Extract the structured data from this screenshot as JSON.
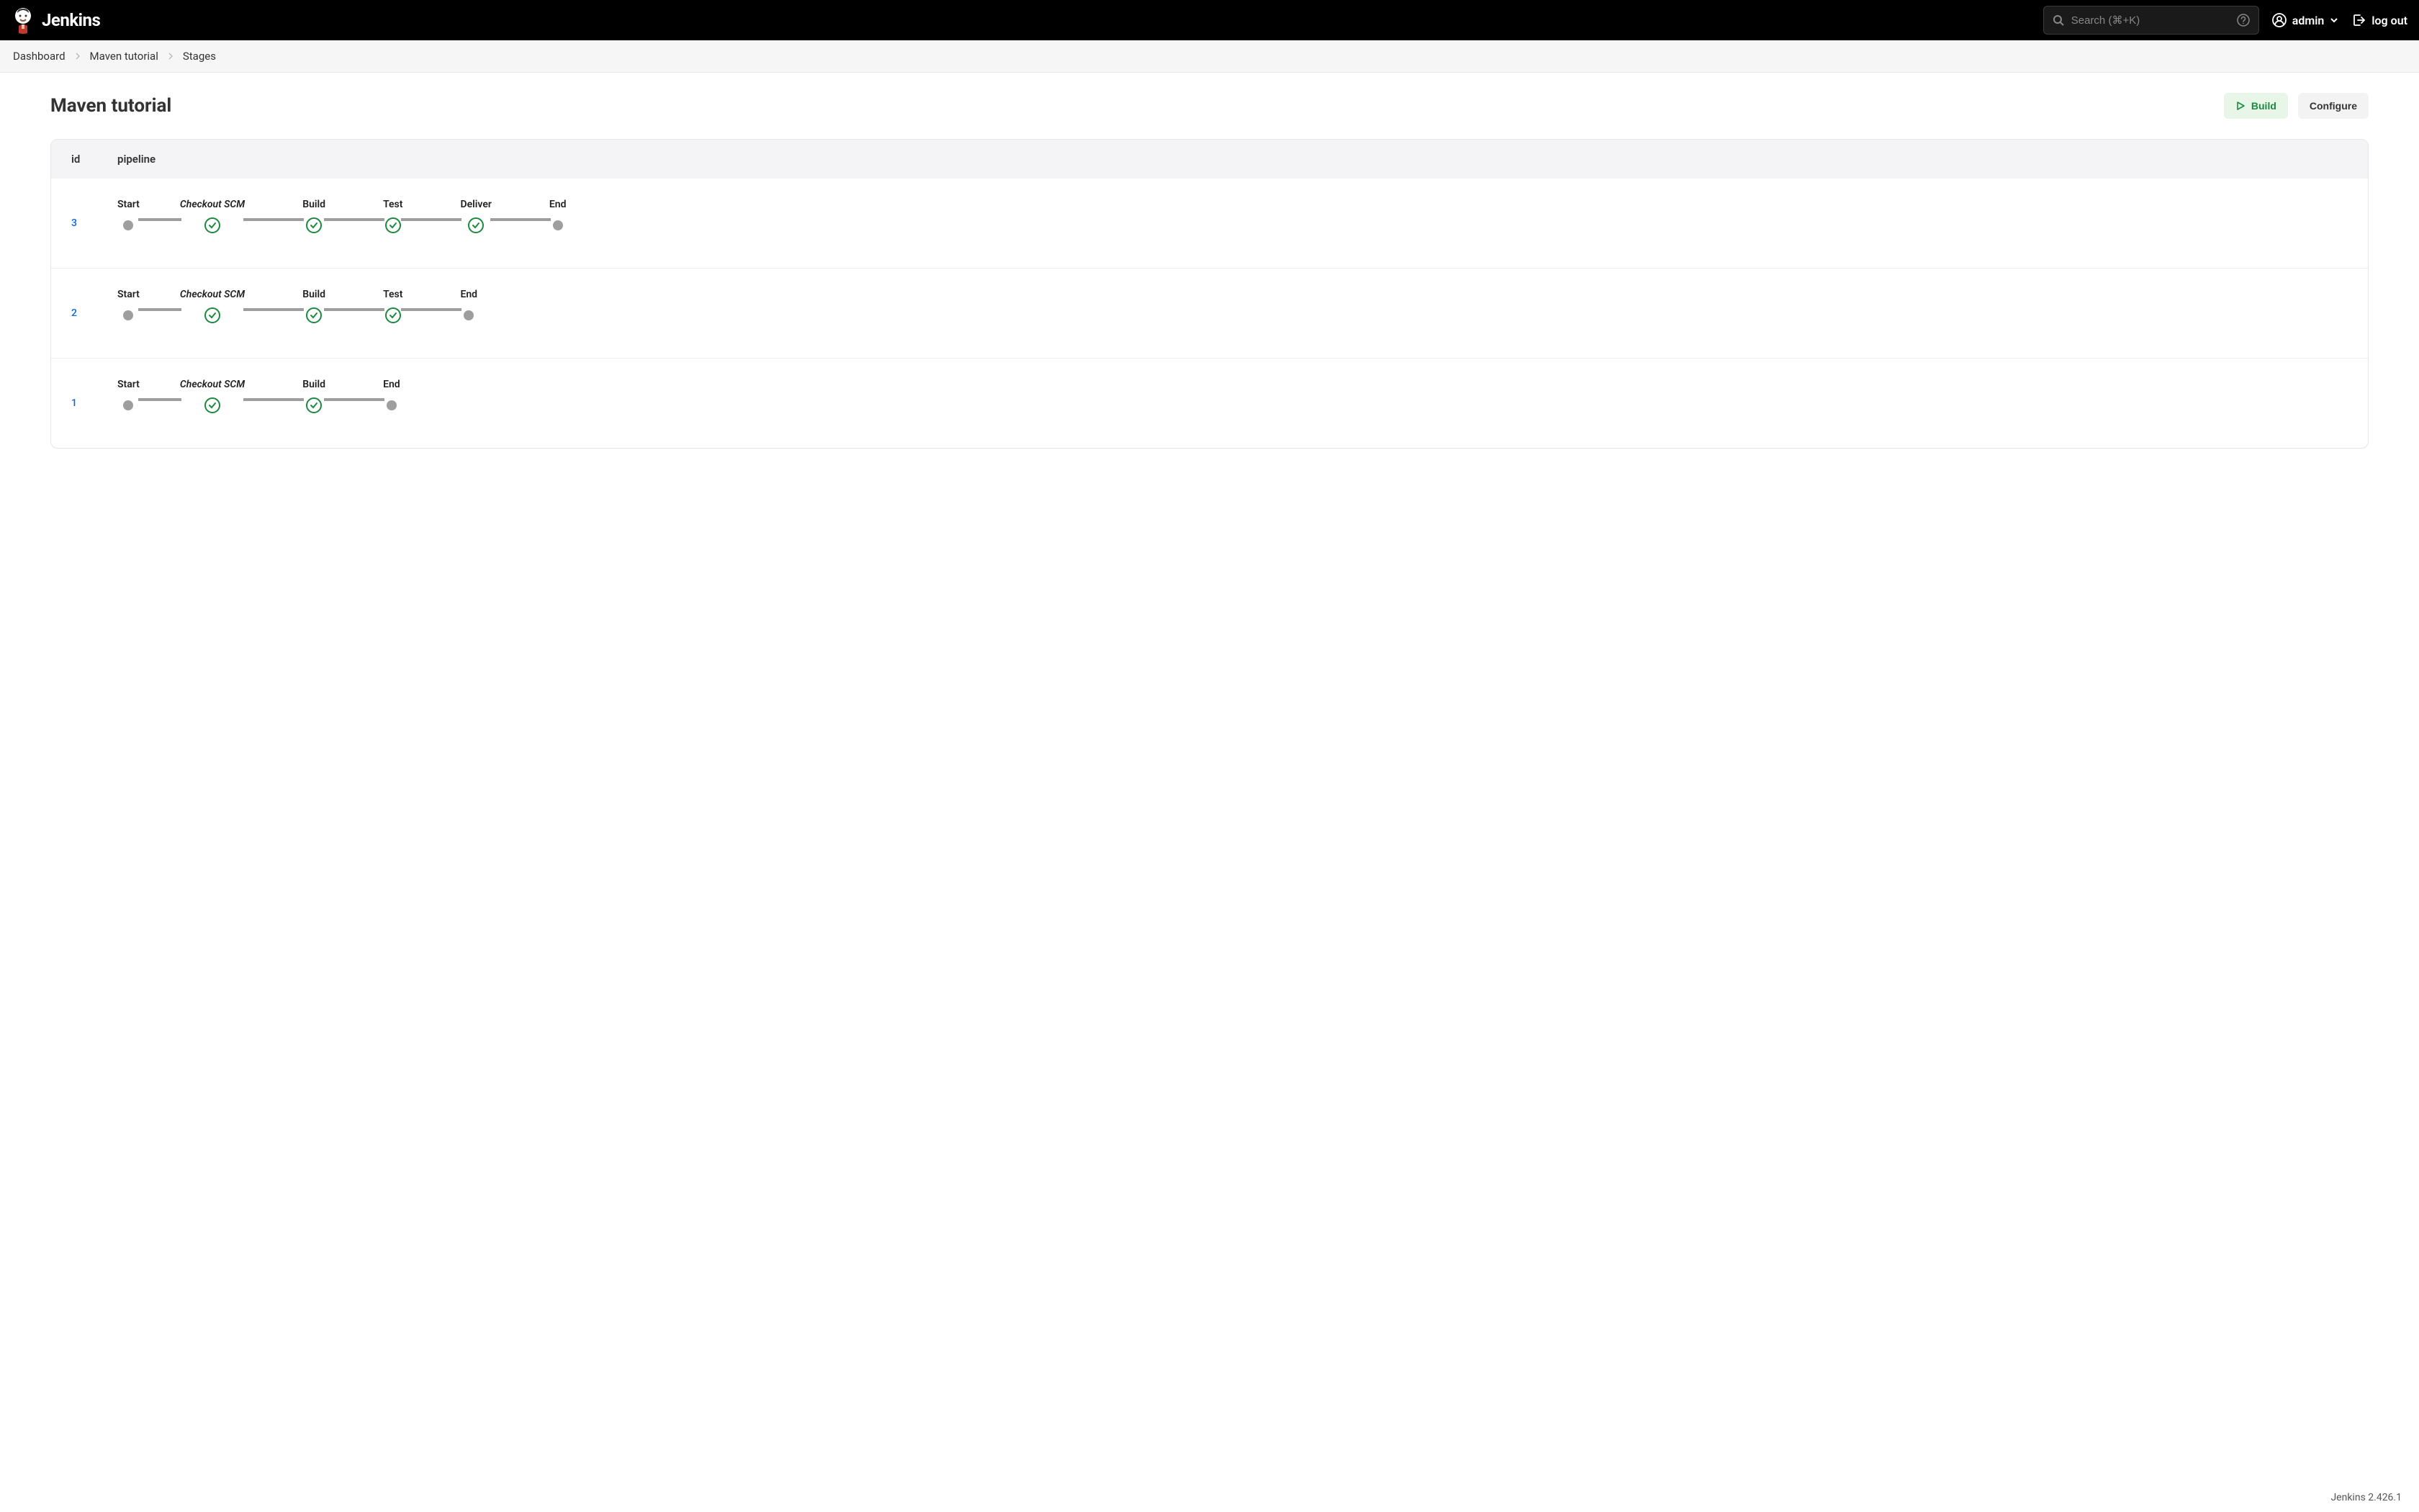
{
  "header": {
    "brand": "Jenkins",
    "search_placeholder": "Search (⌘+K)",
    "user": "admin",
    "logout": "log out"
  },
  "breadcrumbs": [
    "Dashboard",
    "Maven tutorial",
    "Stages"
  ],
  "page": {
    "title": "Maven tutorial",
    "build_label": "Build",
    "configure_label": "Configure"
  },
  "table": {
    "col_id": "id",
    "col_pipeline": "pipeline"
  },
  "runs": [
    {
      "id": "3",
      "stages": [
        {
          "label": "Start",
          "type": "terminal"
        },
        {
          "label": "Checkout SCM",
          "type": "success",
          "scm": true
        },
        {
          "label": "Build",
          "type": "success"
        },
        {
          "label": "Test",
          "type": "success"
        },
        {
          "label": "Deliver",
          "type": "success"
        },
        {
          "label": "End",
          "type": "terminal"
        }
      ]
    },
    {
      "id": "2",
      "stages": [
        {
          "label": "Start",
          "type": "terminal"
        },
        {
          "label": "Checkout SCM",
          "type": "success",
          "scm": true
        },
        {
          "label": "Build",
          "type": "success"
        },
        {
          "label": "Test",
          "type": "success"
        },
        {
          "label": "End",
          "type": "terminal"
        }
      ]
    },
    {
      "id": "1",
      "stages": [
        {
          "label": "Start",
          "type": "terminal"
        },
        {
          "label": "Checkout SCM",
          "type": "success",
          "scm": true
        },
        {
          "label": "Build",
          "type": "success"
        },
        {
          "label": "End",
          "type": "terminal"
        }
      ]
    }
  ],
  "footer": "Jenkins 2.426.1"
}
